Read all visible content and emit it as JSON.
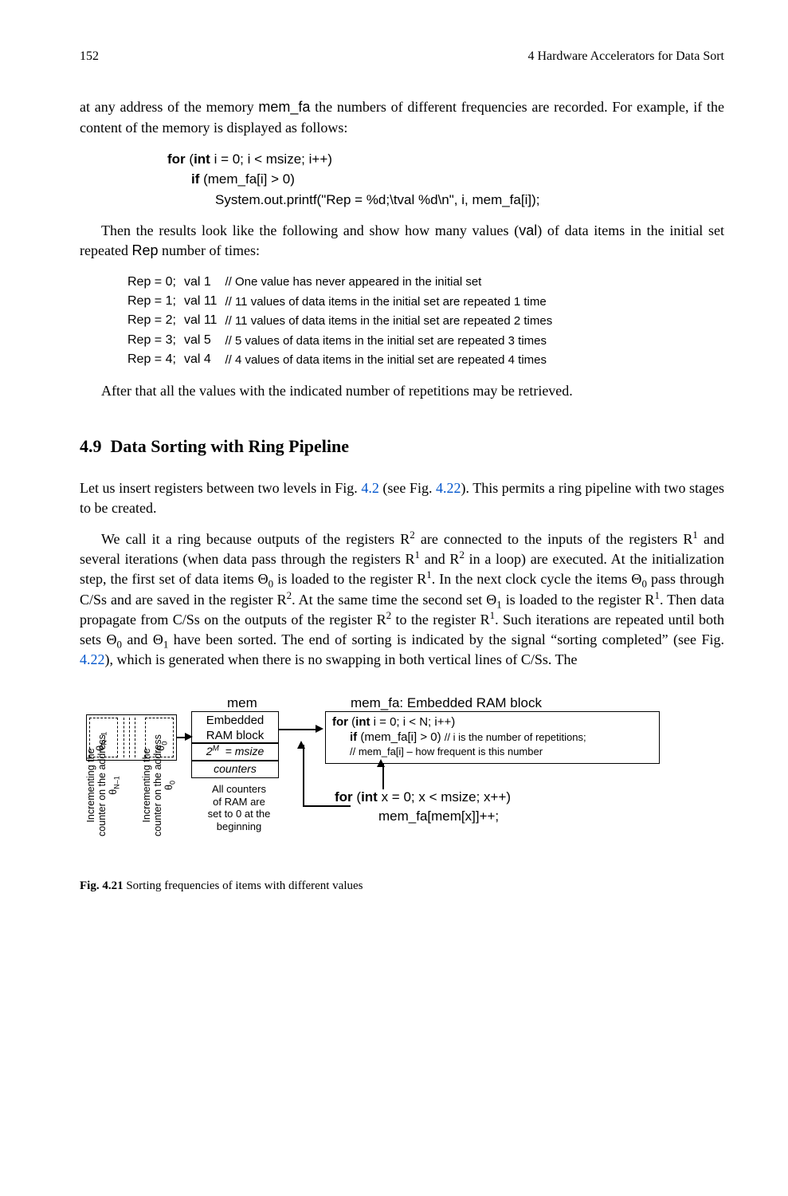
{
  "header": {
    "page": "152",
    "running": "4   Hardware Accelerators for Data Sort"
  },
  "intro1a": "at any address of the memory ",
  "intro1_code": "mem_fa",
  "intro1b": " the numbers of different frequencies are recorded. For example, if the content of the memory is displayed as follows:",
  "code1": {
    "l1a": "for",
    "l1b": " (",
    "l1c": "int",
    "l1d": " i = 0; i < msize; i++)",
    "l2a": "if",
    "l2b": " (mem_fa[i] > 0)",
    "l3": "System.out.printf(\"Rep = %d;\\tval %d\\n\", i, mem_fa[i]);"
  },
  "mid1a": "Then the results look like the following and show how many values (",
  "mid1_code": "val",
  "mid1b": ") of data items in the initial set repeated ",
  "mid1_code2": "Rep",
  "mid1c": " number of times:",
  "results": [
    {
      "rep": "Rep = 0;",
      "val": "val 1",
      "comment": "// One value has never appeared in the initial set"
    },
    {
      "rep": "Rep = 1;",
      "val": "val 11",
      "comment": "// 11 values of data items in the initial set are repeated 1 time"
    },
    {
      "rep": "Rep = 2;",
      "val": "val 11",
      "comment": "// 11 values of data items in the initial set are repeated 2 times"
    },
    {
      "rep": "Rep = 3;",
      "val": "val 5",
      "comment": "// 5 values of data items in the initial set are repeated 3 times"
    },
    {
      "rep": "Rep = 4;",
      "val": "val 4",
      "comment": "// 4 values of data items in the initial set are repeated 4 times"
    }
  ],
  "after_results": "After that all the values with the indicated number of repetitions may be retrieved.",
  "section": {
    "num": "4.9",
    "title": "Data Sorting with Ring Pipeline"
  },
  "p1a": "Let us insert registers between two levels in Fig. ",
  "p1link1": "4.2",
  "p1b": " (see Fig. ",
  "p1link2": "4.22",
  "p1c": "). This permits a ring pipeline with two stages to be created.",
  "p2": "We call it a ring because outputs of the registers R² are connected to the inputs of the registers R¹ and several iterations (when data pass through the registers R¹ and R² in a loop) are executed. At the initialization step, the first set of data items Θ₀ is loaded to the register R¹. In the next clock cycle the items Θ₀ pass through C/Ss and are saved in the register R². At the same time the second set Θ₁ is loaded to the register R¹. Then data propagate from C/Ss on the outputs of the register R² to the register R¹. Such iterations are repeated until both sets Θ₀ and Θ₁ have been sorted. The end of sorting is indicated by the signal \"sorting completed\" (see Fig. ",
  "p2link": "4.22",
  "p2b": "), which is generated when there is no swapping in both vertical lines of C/Ss. The",
  "figure": {
    "mem_label": "mem",
    "embedded": "Embedded\nRAM block",
    "msize": "2ᴹ  = msize",
    "counters": "counters",
    "allset": "All counters\nof RAM are\nset to 0 at the\nbeginning",
    "v1": "Incrementing the counter on the address θ",
    "v1sub": "N–1",
    "v2": "Incrementing the counter on the address θ",
    "v2sub": "0",
    "theta_n1": "θ",
    "theta_n1_sub": "N–1",
    "theta_0": "θ",
    "theta_0_sub": "0",
    "memfa_title": "mem_fa: Embedded RAM block",
    "c1a": "for",
    "c1b": " (",
    "c1c": "int",
    "c1d": " i = 0; i < N; i++)",
    "c2a": "if",
    "c2b": " (mem_fa[i] > 0)  ",
    "c2c": "// i is the number of repetitions;",
    "c3": "// mem_fa[i] – how frequent is this number",
    "d1a": "for",
    "d1b": " (",
    "d1c": "int",
    "d1d": " x = 0; x < msize; x++)",
    "d2": "mem_fa[mem[x]]++;"
  },
  "caption": {
    "num": "Fig. 4.21",
    "text": "  Sorting frequencies of items with different values"
  }
}
